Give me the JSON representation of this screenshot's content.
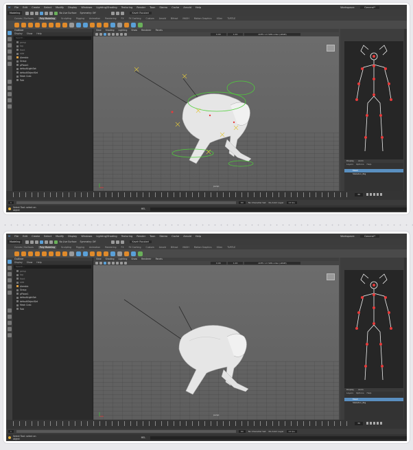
{
  "menus": [
    "File",
    "Edit",
    "Create",
    "Select",
    "Modify",
    "Display",
    "Windows",
    "Lighting/Shading",
    "Texturing",
    "Render",
    "Toon",
    "Stereo",
    "Cache",
    "Arnold",
    "Help"
  ],
  "workspace": {
    "label": "Workspace:",
    "value": "General*"
  },
  "mode": "Modeling",
  "status": {
    "live_surface": "No Live Surface",
    "symmetry": "Symmetry: Off",
    "signin": "Kaveh Roustaei"
  },
  "shelf_tabs": [
    "Curves / Surfaces",
    "Poly Modeling",
    "Sculpting",
    "Rigging",
    "Animation",
    "Rendering",
    "FX",
    "FX Caching",
    "Custom",
    "Arnold",
    "Bifrost",
    "MASH",
    "Motion Graphics",
    "XGen",
    "TURTLE"
  ],
  "shelf_active": "Poly Modeling",
  "outliner": {
    "title": "Outliner",
    "menu": [
      "Display",
      "Show",
      "Help"
    ],
    "search": "Search...",
    "rows": [
      "persp",
      "top",
      "front",
      "side",
      "Alembic",
      "Group",
      "pPlane1",
      "defaultLightSet",
      "defaultObjectSet",
      "Mesh Crab",
      "Tubi"
    ]
  },
  "viewport": {
    "menu": [
      "View",
      "Shading",
      "Lighting",
      "Show",
      "Renderer",
      "Panels"
    ],
    "colorspace": "ACES 1.0 SDR-video (sRGB)",
    "values": [
      "0.00",
      "1.00"
    ],
    "label": "persp"
  },
  "layers": {
    "tabs": [
      "Display",
      "Anim"
    ],
    "menu": [
      "Layers",
      "Options",
      "Help"
    ],
    "rows": [
      "Mesh",
      "Skeleton_Rig"
    ]
  },
  "timeline": {
    "current_frame": "30",
    "start": "1",
    "end": "60"
  },
  "range": {
    "start": "1",
    "end": "60",
    "fps": "24 fps",
    "char_set": "No Character Set",
    "anim_layer": "No Anim Layer"
  },
  "helpline": {
    "text": "Select Tool: select an object",
    "mel": "MEL"
  },
  "colors": {
    "accent": "#5aa0d8",
    "shelf_icon": "#e08a2a",
    "rig_green": "#4fd13a",
    "rig_yellow": "#e0c63a",
    "joint_red": "#e83a3a"
  }
}
